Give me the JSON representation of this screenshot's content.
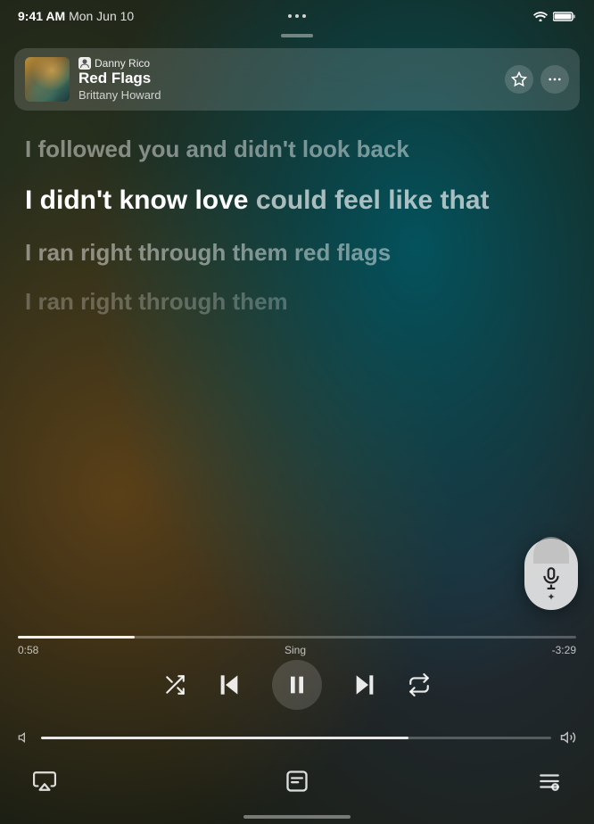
{
  "status_bar": {
    "time": "9:41 AM",
    "date": "Mon Jun 10",
    "wifi": "100%",
    "battery": "100%"
  },
  "now_playing": {
    "username": "Danny Rico",
    "track_title": "Red Flags",
    "artist": "Brittany Howard",
    "favorite_label": "Favorite",
    "more_label": "More options"
  },
  "lyrics": {
    "line_past": "I followed you and didn't look back",
    "line_active_bold": "I didn't know love",
    "line_active_dim": "could feel like that",
    "line_future1": "I ran right through them red flags",
    "line_future2": "I ran right through them"
  },
  "progress": {
    "elapsed": "0:58",
    "mode": "Sing",
    "remaining": "-3:29",
    "fill_percent": 21
  },
  "controls": {
    "shuffle": "Shuffle",
    "previous": "Previous",
    "play_pause": "Pause",
    "next": "Next",
    "repeat": "Repeat"
  },
  "volume": {
    "fill_percent": 72,
    "mute_label": "Mute",
    "max_label": "Max volume"
  },
  "bottom_bar": {
    "airplay_label": "AirPlay",
    "lyrics_label": "Lyrics",
    "queue_label": "Queue"
  },
  "mic_button": {
    "label": "Sing mode"
  }
}
